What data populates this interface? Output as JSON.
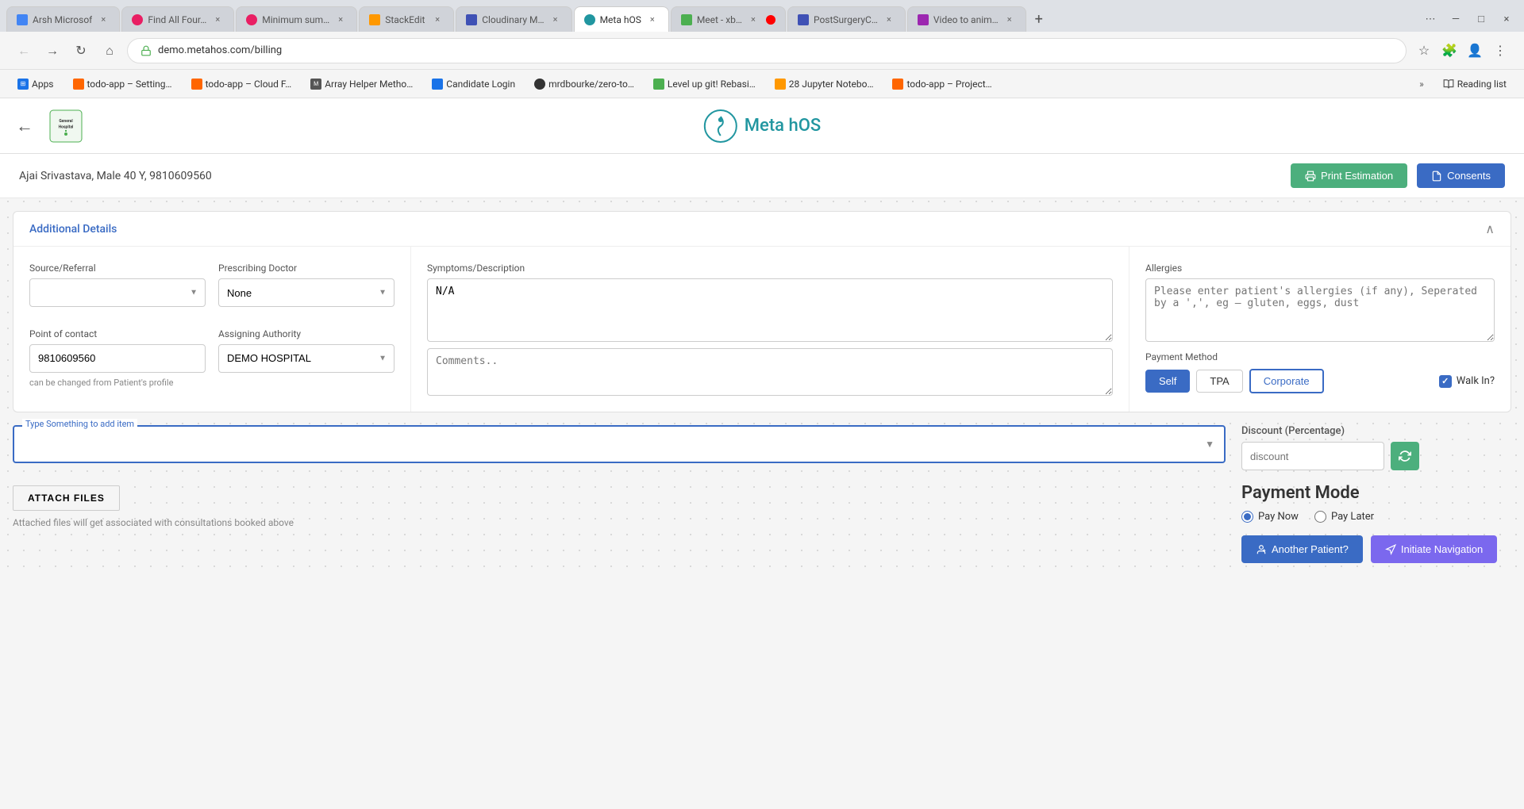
{
  "browser": {
    "url": "demo.metahos.com/billing",
    "tabs": [
      {
        "id": 1,
        "label": "Arsh Microsof",
        "active": true,
        "favicon_color": "#4285f4"
      },
      {
        "id": 2,
        "label": "Find All Four…",
        "active": false,
        "favicon_color": "#e91e63"
      },
      {
        "id": 3,
        "label": "Minimum sum…",
        "active": false,
        "favicon_color": "#e91e63"
      },
      {
        "id": 4,
        "label": "StackEdit",
        "active": false,
        "favicon_color": "#ff9800"
      },
      {
        "id": 5,
        "label": "Cloudinary M…",
        "active": false,
        "favicon_color": "#3f51b5"
      },
      {
        "id": 6,
        "label": "Meta hOS",
        "active": true,
        "favicon_color": "#2196a0"
      },
      {
        "id": 7,
        "label": "Meet - xb…",
        "active": false,
        "favicon_color": "#4caf50"
      },
      {
        "id": 8,
        "label": "PostSurgeryC…",
        "active": false,
        "favicon_color": "#3f51b5"
      },
      {
        "id": 9,
        "label": "Video to anim…",
        "active": false,
        "favicon_color": "#9c27b0"
      }
    ],
    "bookmarks": [
      {
        "label": "Apps",
        "favicon_color": "#1a73e8"
      },
      {
        "label": "todo-app – Setting…",
        "favicon_color": "#ff6600"
      },
      {
        "label": "todo-app – Cloud F…",
        "favicon_color": "#ff6600"
      },
      {
        "label": "Array Helper Metho…",
        "favicon_color": "#555"
      },
      {
        "label": "Candidate Login",
        "favicon_color": "#1a73e8"
      },
      {
        "label": "mrdbourke/zero-to…",
        "favicon_color": "#333"
      },
      {
        "label": "Level up git! Rebasi…",
        "favicon_color": "#4caf50"
      },
      {
        "label": "28 Jupyter Notebo…",
        "favicon_color": "#ff9800"
      },
      {
        "label": "todo-app – Project…",
        "favicon_color": "#ff6600"
      }
    ],
    "reading_list_label": "Reading list"
  },
  "app": {
    "back_label": "←",
    "hospital": {
      "name": "General Hospital",
      "logo_color": "#4caf50"
    },
    "brand": {
      "name": "Meta hOS",
      "icon_color": "#2196a0"
    }
  },
  "patient": {
    "info": "Ajai Srivastava, Male 40 Y, 9810609560",
    "actions": {
      "print_label": "Print Estimation",
      "consents_label": "Consents"
    }
  },
  "additional_details": {
    "title": "Additional Details",
    "collapse_icon": "∧",
    "fields": {
      "source_referral": {
        "label": "Source/Referral",
        "value": "",
        "placeholder": ""
      },
      "prescribing_doctor": {
        "label": "Prescribing Doctor",
        "value": "None",
        "options": [
          "None"
        ]
      },
      "symptoms_description": {
        "label": "Symptoms/Description",
        "value": "N/A"
      },
      "allergies": {
        "label": "Allergies",
        "placeholder": "Please enter patient's allergies (if any), Seperated by a ',', eg – gluten, eggs, dust"
      },
      "point_of_contact": {
        "label": "Point of contact",
        "value": "9810609560",
        "helper": "can be changed from Patient's profile"
      },
      "assigning_authority": {
        "label": "Assigning Authority",
        "value": "DEMO HOSPITAL",
        "options": [
          "DEMO HOSPITAL"
        ]
      },
      "comments": {
        "label": "",
        "placeholder": "Comments.."
      },
      "payment_method": {
        "label": "Payment Method",
        "buttons": [
          "Self",
          "TPA",
          "Corporate"
        ],
        "active": "Self"
      },
      "walk_in": {
        "label": "Walk In?",
        "checked": true
      }
    }
  },
  "item_search": {
    "label": "Type Something to add item",
    "placeholder": ""
  },
  "attach_files": {
    "button_label": "ATTACH FILES",
    "helper": "Attached files will get associated with consultations booked above"
  },
  "discount": {
    "label": "Discount (Percentage)",
    "placeholder": "discount",
    "apply_icon": "↻"
  },
  "payment_mode": {
    "title": "Payment Mode",
    "options": [
      "Pay Now",
      "Pay Later"
    ],
    "selected": "Pay Now"
  },
  "action_buttons": {
    "another_patient": "Another Patient?",
    "initiate_navigation": "Initiate Navigation"
  }
}
